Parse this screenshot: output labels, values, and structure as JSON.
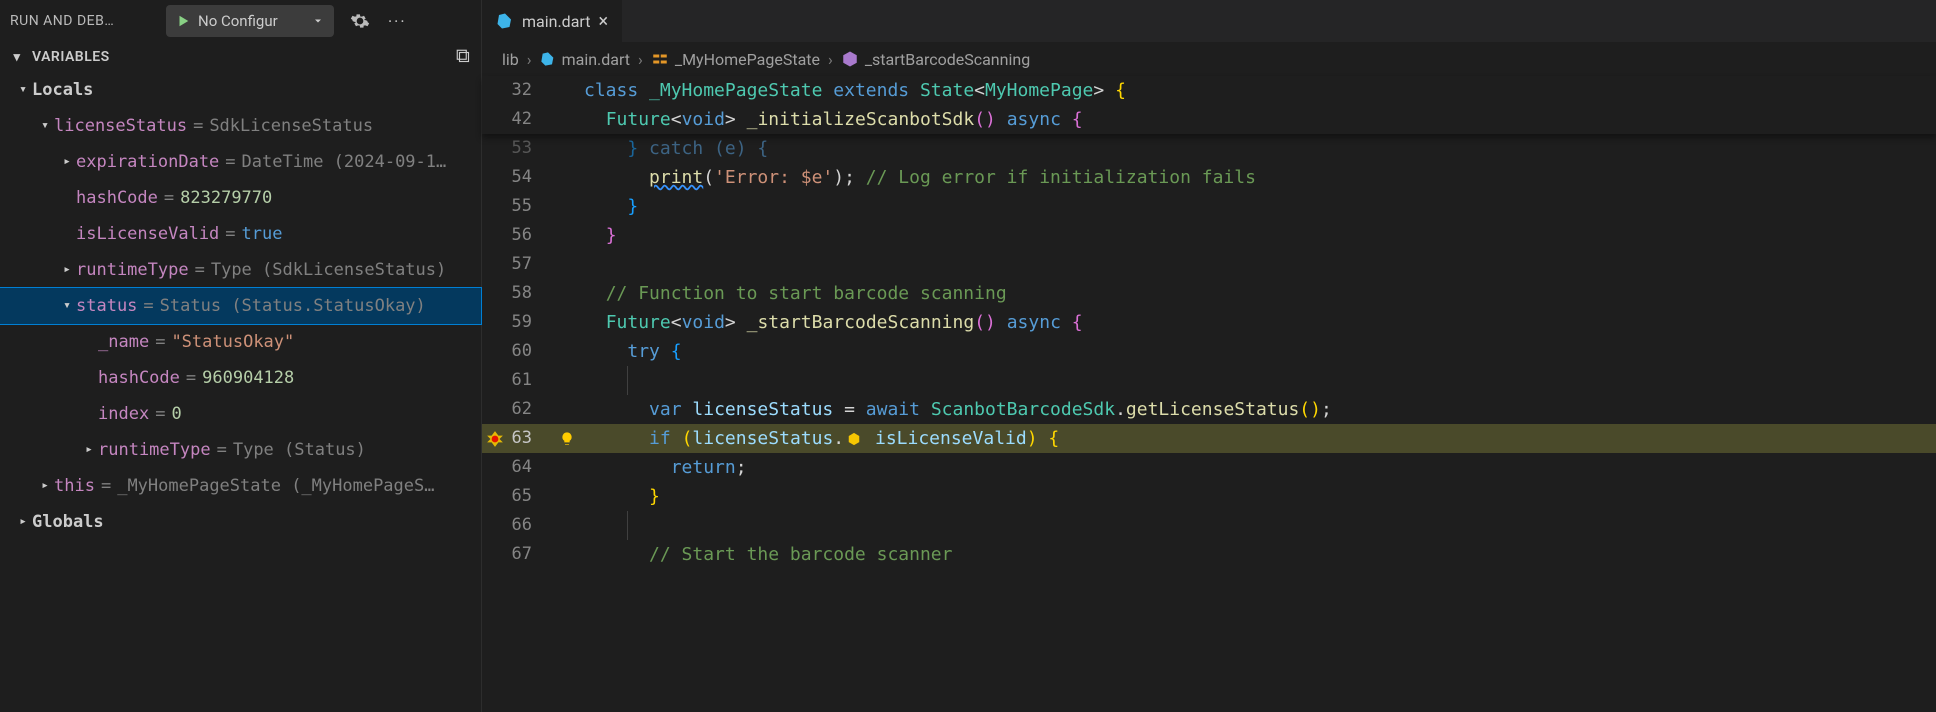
{
  "debug_panel_title": "RUN AND DEB…",
  "config_selector": "No Configur",
  "variables_label": "VARIABLES",
  "scopes": {
    "locals": "Locals",
    "globals": "Globals"
  },
  "vars": {
    "licenseStatus": {
      "name": "licenseStatus",
      "value": "SdkLicenseStatus",
      "children": {
        "expirationDate": {
          "name": "expirationDate",
          "value": "DateTime (2024-09-1…"
        },
        "hashCode": {
          "name": "hashCode",
          "value": "823279770"
        },
        "isLicenseValid": {
          "name": "isLicenseValid",
          "value": "true"
        },
        "runtimeType": {
          "name": "runtimeType",
          "value": "Type (SdkLicenseStatus)"
        },
        "status": {
          "name": "status",
          "value": "Status (Status.StatusOkay)",
          "children": {
            "_name": {
              "name": "_name",
              "value": "\"StatusOkay\""
            },
            "hashCode": {
              "name": "hashCode",
              "value": "960904128"
            },
            "index": {
              "name": "index",
              "value": "0"
            },
            "runtimeType": {
              "name": "runtimeType",
              "value": "Type (Status)"
            }
          }
        }
      }
    },
    "this": {
      "name": "this",
      "value": "_MyHomePageState (_MyHomePageS…"
    }
  },
  "tab": {
    "filename": "main.dart"
  },
  "breadcrumb": {
    "folder": "lib",
    "file": "main.dart",
    "class": "_MyHomePageState",
    "method": "_startBarcodeScanning"
  },
  "sticky": {
    "l32_num": "32",
    "l32_kw_class": "class",
    "l32_classname": "_MyHomePageState",
    "l32_kw_extends": "extends",
    "l32_state": "State",
    "l32_generic": "MyHomePage",
    "l42_num": "42",
    "l42_future": "Future",
    "l42_void": "void",
    "l42_fn": "_initializeScanbotSdk",
    "l42_async": "async"
  },
  "code": {
    "l53": {
      "num": "53",
      "catch_tail": " catch (e) {"
    },
    "l54": {
      "num": "54",
      "print": "print",
      "str": "'Error: $e'",
      "cmt": "// Log error if initialization fails"
    },
    "l55": {
      "num": "55"
    },
    "l56": {
      "num": "56"
    },
    "l57": {
      "num": "57"
    },
    "l58": {
      "num": "58",
      "cmt": "// Function to start barcode scanning"
    },
    "l59": {
      "num": "59",
      "future": "Future",
      "void": "void",
      "fn": "_startBarcodeScanning",
      "async": "async"
    },
    "l60": {
      "num": "60",
      "try": "try"
    },
    "l61": {
      "num": "61"
    },
    "l62": {
      "num": "62",
      "var": "var",
      "ident": "licenseStatus",
      "await": "await",
      "cls": "ScanbotBarcodeSdk",
      "method": "getLicenseStatus"
    },
    "l63": {
      "num": "63",
      "if": "if",
      "ident": "licenseStatus",
      "prop": "isLicenseValid"
    },
    "l64": {
      "num": "64",
      "return": "return"
    },
    "l65": {
      "num": "65"
    },
    "l66": {
      "num": "66"
    },
    "l67": {
      "num": "67",
      "cmt": "// Start the barcode scanner"
    }
  }
}
